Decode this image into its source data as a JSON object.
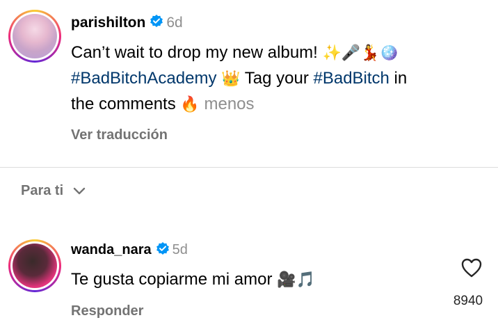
{
  "post": {
    "username": "parishilton",
    "time": "6d",
    "caption_text1": "Can’t wait to drop my new album!",
    "caption_emojis1": "✨🎤💃🪩",
    "hashtag1": "#BadBitchAcademy",
    "crown": "👑",
    "caption_text2": " Tag your ",
    "hashtag2": "#BadBitch",
    "caption_text3": " in",
    "caption_text4": "the comments",
    "fire": "🔥",
    "less_label": "menos",
    "translate_label": "Ver traducción"
  },
  "feed": {
    "for_you_label": "Para ti"
  },
  "comment": {
    "username": "wanda_nara",
    "time": "5d",
    "text": "Te gusta copiarme mi amor",
    "emojis": "🎥🎵",
    "reply_label": "Responder",
    "likes": "8940"
  },
  "colors": {
    "verified": "#0095f6",
    "hashtag": "#00376b",
    "muted": "#8e8e8e"
  }
}
